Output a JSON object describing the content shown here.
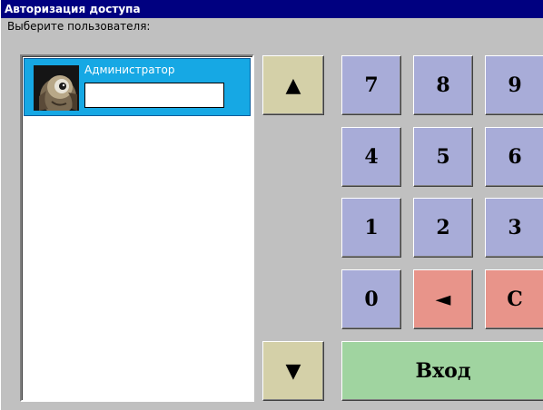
{
  "window": {
    "title": "Авторизация доступа"
  },
  "prompt": "Выберите пользователя:",
  "users": [
    {
      "name": "Администратор",
      "password_value": ""
    }
  ],
  "scroll": {
    "up_label": "▲",
    "down_label": "▼"
  },
  "keypad": {
    "k7": "7",
    "k8": "8",
    "k9": "9",
    "k4": "4",
    "k5": "5",
    "k6": "6",
    "k1": "1",
    "k2": "2",
    "k3": "3",
    "k0": "0",
    "backspace": "◄",
    "clear": "C"
  },
  "enter_label": "Вход",
  "colors": {
    "title_bg": "#000080",
    "selected_item": "#16a8e4",
    "number_key": "#a8acd8",
    "control_key": "#e8948a",
    "arrow_key": "#d4d0a8",
    "enter_key": "#a0d4a0"
  }
}
